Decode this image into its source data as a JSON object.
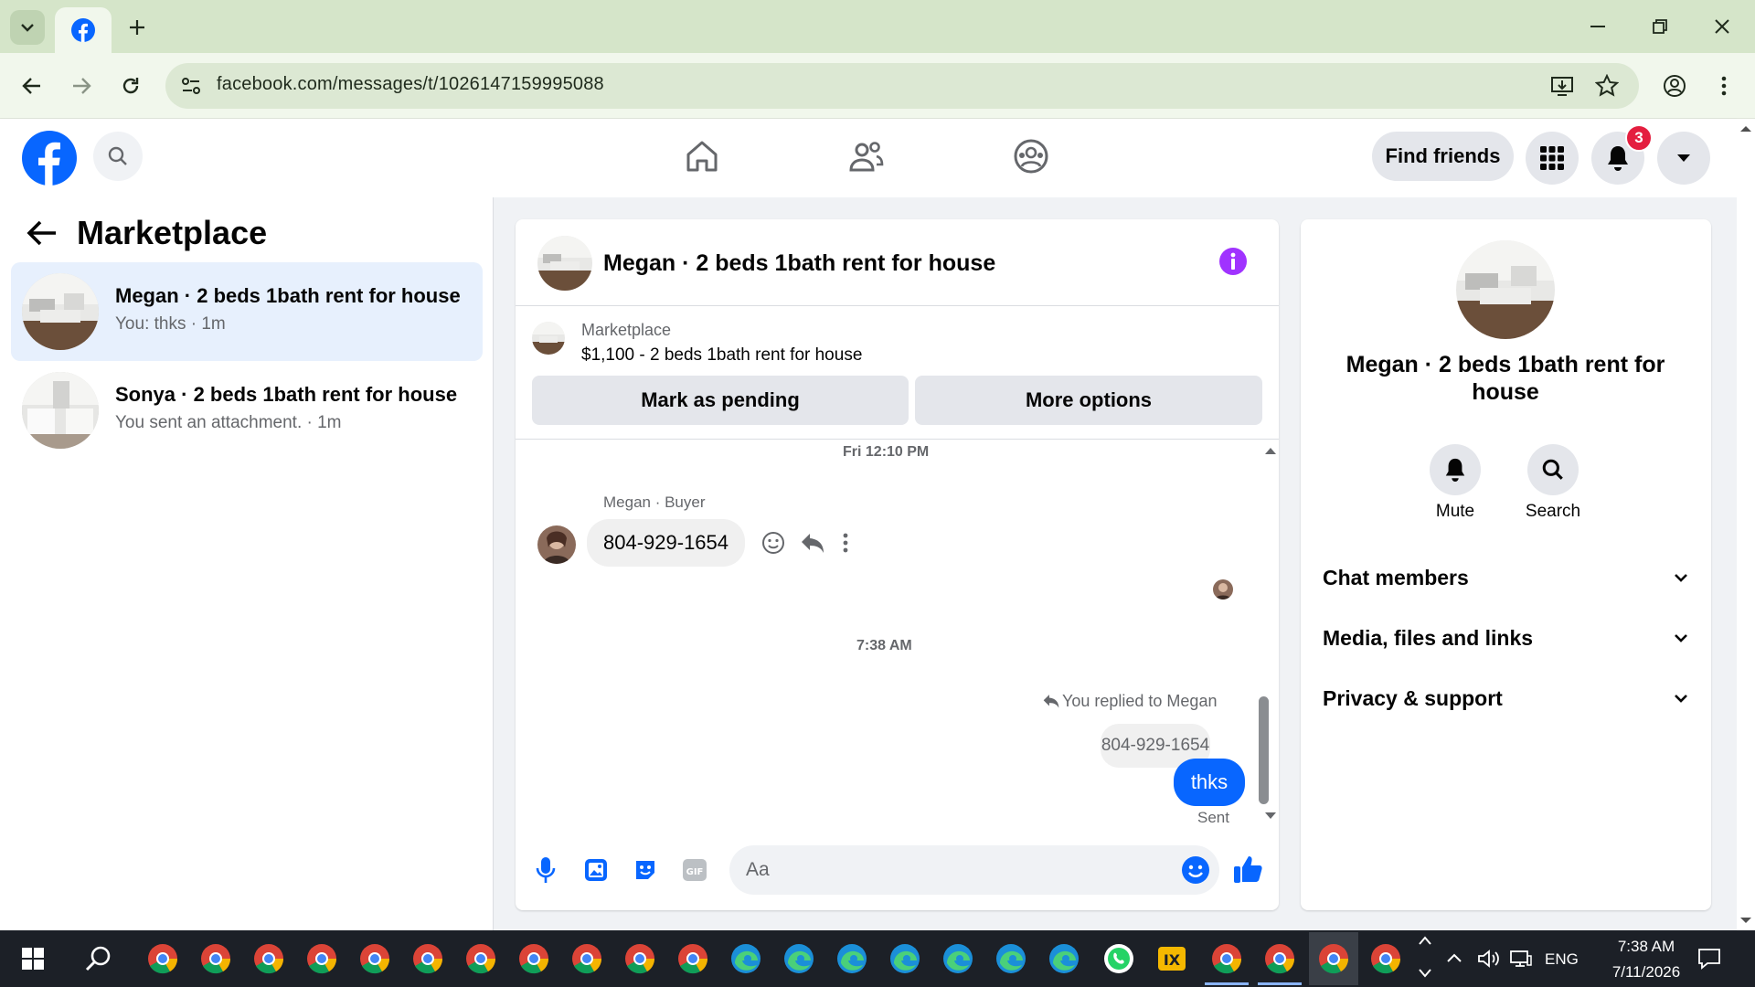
{
  "browser": {
    "url": "facebook.com/messages/t/1026147159995088"
  },
  "fb": {
    "find_friends": "Find friends",
    "notification_count": "3"
  },
  "left": {
    "title": "Marketplace",
    "conversations": [
      {
        "name": "Megan · 2 beds 1bath rent for house",
        "sub": "You: thks · 1m"
      },
      {
        "name": "Sonya · 2 beds 1bath rent for house",
        "sub": "You sent an attachment. · 1m"
      }
    ]
  },
  "chat": {
    "title": "Megan · 2 beds 1bath rent for house",
    "listing_label": "Marketplace",
    "listing_title": "$1,100 - 2 beds 1bath rent for house",
    "mark_pending": "Mark as pending",
    "more_options": "More options",
    "timestamp1": "Fri 12:10 PM",
    "sender_label": "Megan · Buyer",
    "incoming_message": "804-929-1654",
    "timestamp2": "7:38 AM",
    "replied_to": "You replied to Megan",
    "quoted_message": "804-929-1654",
    "outgoing_message": "thks",
    "sent_status": "Sent",
    "composer_placeholder": "Aa"
  },
  "info": {
    "title": "Megan · 2 beds 1bath rent for house",
    "mute": "Mute",
    "search": "Search",
    "sections": [
      "Chat members",
      "Media, files and links",
      "Privacy & support"
    ]
  },
  "taskbar": {
    "time": "7:38 AM",
    "date": "7/11/2026",
    "lang": "ENG"
  },
  "colors": {
    "accent": "#0866ff",
    "chrome_green": "#d5e5c9",
    "info_purple": "#a033ff",
    "badge_red": "#e41e3f"
  }
}
